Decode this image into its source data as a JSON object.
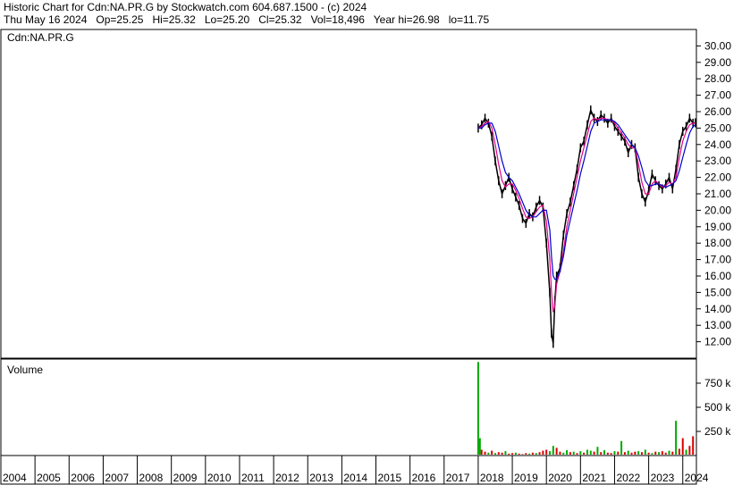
{
  "header": {
    "line1": "Historic Chart for Cdn:NA.PR.G by Stockwatch.com 604.687.1500 - (c) 2024",
    "line2": "Thu May 16 2024   Op=25.25   Hi=25.32   Lo=25.20   Cl=25.32   Vol=18,496   Year hi=26.98   lo=11.75"
  },
  "colors": {
    "price": "#000000",
    "ma_short": "#e0008a",
    "ma_long": "#0000cc",
    "vol_up": "#00aa00",
    "vol_down": "#dd0000",
    "grid": "#000000"
  },
  "chart_data": [
    {
      "type": "line",
      "legend": "Cdn:NA.PR.G",
      "ylim": [
        11.0,
        31.0
      ],
      "yticks": [
        "30.00",
        "29.00",
        "28.00",
        "27.00",
        "26.00",
        "25.00",
        "24.00",
        "23.00",
        "22.00",
        "21.00",
        "20.00",
        "19.00",
        "18.00",
        "17.00",
        "16.00",
        "15.00",
        "14.00",
        "13.00",
        "12.00"
      ],
      "xlim": [
        2004.0,
        2024.4
      ],
      "x": [
        2018.0,
        2018.1,
        2018.2,
        2018.3,
        2018.4,
        2018.5,
        2018.6,
        2018.7,
        2018.8,
        2018.9,
        2019.0,
        2019.1,
        2019.2,
        2019.3,
        2019.4,
        2019.5,
        2019.6,
        2019.7,
        2019.8,
        2019.9,
        2020.0,
        2020.1,
        2020.15,
        2020.2,
        2020.25,
        2020.3,
        2020.4,
        2020.5,
        2020.6,
        2020.7,
        2020.8,
        2020.9,
        2021.0,
        2021.1,
        2021.2,
        2021.3,
        2021.4,
        2021.5,
        2021.6,
        2021.7,
        2021.8,
        2021.9,
        2022.0,
        2022.1,
        2022.2,
        2022.3,
        2022.4,
        2022.5,
        2022.6,
        2022.7,
        2022.8,
        2022.9,
        2023.0,
        2023.1,
        2023.2,
        2023.3,
        2023.4,
        2023.5,
        2023.6,
        2023.7,
        2023.8,
        2023.9,
        2024.0,
        2024.1,
        2024.2,
        2024.3,
        2024.37
      ],
      "y": [
        25.0,
        25.2,
        25.6,
        25.3,
        24.5,
        23.0,
        21.8,
        21.0,
        21.5,
        22.0,
        21.3,
        20.8,
        20.3,
        19.5,
        19.2,
        19.8,
        19.6,
        20.2,
        20.6,
        20.2,
        18.0,
        15.0,
        12.5,
        11.9,
        14.5,
        16.0,
        16.5,
        18.5,
        19.8,
        20.5,
        21.5,
        22.5,
        23.8,
        24.2,
        25.2,
        26.1,
        25.6,
        25.4,
        25.8,
        25.6,
        25.3,
        25.6,
        25.1,
        24.8,
        24.5,
        24.2,
        23.5,
        24.0,
        23.8,
        22.0,
        21.0,
        20.5,
        21.2,
        22.2,
        21.8,
        21.5,
        21.3,
        21.6,
        22.0,
        21.3,
        22.5,
        24.0,
        24.8,
        25.1,
        25.6,
        25.3,
        25.32
      ],
      "ma_short": [
        25.0,
        25.1,
        25.3,
        25.4,
        25.0,
        24.0,
        22.8,
        21.8,
        21.4,
        21.6,
        21.6,
        21.2,
        20.7,
        20.1,
        19.6,
        19.5,
        19.6,
        19.9,
        20.2,
        20.3,
        19.3,
        17.0,
        15.0,
        13.8,
        14.2,
        15.5,
        16.3,
        17.5,
        19.0,
        20.0,
        21.0,
        22.0,
        23.0,
        23.8,
        24.6,
        25.4,
        25.6,
        25.5,
        25.6,
        25.6,
        25.5,
        25.5,
        25.3,
        25.0,
        24.7,
        24.4,
        24.0,
        23.8,
        23.8,
        22.8,
        21.7,
        21.0,
        21.0,
        21.6,
        21.8,
        21.6,
        21.4,
        21.5,
        21.7,
        21.6,
        22.0,
        23.2,
        24.2,
        24.8,
        25.2,
        25.3,
        25.3
      ],
      "ma_long": [
        25.0,
        25.0,
        25.2,
        25.3,
        25.3,
        24.8,
        23.9,
        23.0,
        22.3,
        22.0,
        21.8,
        21.4,
        21.0,
        20.5,
        20.0,
        19.7,
        19.6,
        19.6,
        19.8,
        20.0,
        20.0,
        18.8,
        17.2,
        16.0,
        15.8,
        15.8,
        16.3,
        17.2,
        18.5,
        19.4,
        20.3,
        21.2,
        22.2,
        23.0,
        23.9,
        24.8,
        25.3,
        25.4,
        25.5,
        25.5,
        25.5,
        25.5,
        25.4,
        25.2,
        24.9,
        24.6,
        24.3,
        24.0,
        23.8,
        23.3,
        22.6,
        21.8,
        21.5,
        21.5,
        21.6,
        21.6,
        21.5,
        21.4,
        21.5,
        21.6,
        21.8,
        22.4,
        23.2,
        24.0,
        24.7,
        25.1,
        25.2
      ]
    },
    {
      "type": "bar",
      "title": "Volume",
      "ylim": [
        0,
        1000000
      ],
      "yticks": [
        "750 k",
        "500 k",
        "250 k"
      ],
      "ytick_values": [
        750000,
        500000,
        250000
      ],
      "x": [
        2018.0,
        2018.05,
        2018.1,
        2018.2,
        2018.3,
        2018.4,
        2018.5,
        2018.6,
        2018.7,
        2018.8,
        2018.9,
        2019.0,
        2019.1,
        2019.2,
        2019.3,
        2019.4,
        2019.5,
        2019.6,
        2019.7,
        2019.8,
        2019.9,
        2020.0,
        2020.1,
        2020.2,
        2020.3,
        2020.4,
        2020.5,
        2020.6,
        2020.7,
        2020.8,
        2020.9,
        2021.0,
        2021.1,
        2021.2,
        2021.3,
        2021.4,
        2021.5,
        2021.6,
        2021.7,
        2021.8,
        2021.9,
        2022.0,
        2022.1,
        2022.2,
        2022.3,
        2022.4,
        2022.5,
        2022.6,
        2022.7,
        2022.8,
        2022.9,
        2023.0,
        2023.1,
        2023.2,
        2023.3,
        2023.4,
        2023.5,
        2023.6,
        2023.7,
        2023.8,
        2023.9,
        2024.0,
        2024.1,
        2024.2,
        2024.3
      ],
      "values": [
        970000,
        180000,
        60000,
        40000,
        30000,
        50000,
        25000,
        35000,
        30000,
        45000,
        20000,
        25000,
        30000,
        20000,
        15000,
        25000,
        20000,
        30000,
        25000,
        35000,
        50000,
        60000,
        45000,
        100000,
        80000,
        40000,
        30000,
        55000,
        35000,
        40000,
        25000,
        45000,
        30000,
        60000,
        50000,
        40000,
        90000,
        35000,
        55000,
        30000,
        25000,
        45000,
        40000,
        150000,
        35000,
        50000,
        30000,
        40000,
        45000,
        35000,
        60000,
        30000,
        25000,
        40000,
        35000,
        45000,
        30000,
        50000,
        40000,
        360000,
        70000,
        180000,
        60000,
        100000,
        200000
      ],
      "up": [
        true,
        true,
        false,
        false,
        true,
        false,
        true,
        false,
        false,
        true,
        false,
        false,
        true,
        false,
        false,
        false,
        true,
        false,
        true,
        false,
        false,
        false,
        true,
        true,
        false,
        false,
        true,
        true,
        false,
        true,
        false,
        true,
        false,
        true,
        true,
        false,
        true,
        false,
        true,
        false,
        false,
        true,
        false,
        true,
        false,
        true,
        false,
        false,
        true,
        false,
        true,
        false,
        true,
        false,
        true,
        false,
        false,
        true,
        false,
        true,
        false,
        false,
        true,
        false,
        false
      ]
    }
  ],
  "x_axis": {
    "labels": [
      "2004",
      "2005",
      "2006",
      "2007",
      "2008",
      "2009",
      "2010",
      "2011",
      "2012",
      "2013",
      "2014",
      "2015",
      "2016",
      "2017",
      "2018",
      "2019",
      "2020",
      "2021",
      "2022",
      "2023",
      "2024"
    ],
    "values": [
      2004,
      2005,
      2006,
      2007,
      2008,
      2009,
      2010,
      2011,
      2012,
      2013,
      2014,
      2015,
      2016,
      2017,
      2018,
      2019,
      2020,
      2021,
      2022,
      2023,
      2024
    ]
  }
}
